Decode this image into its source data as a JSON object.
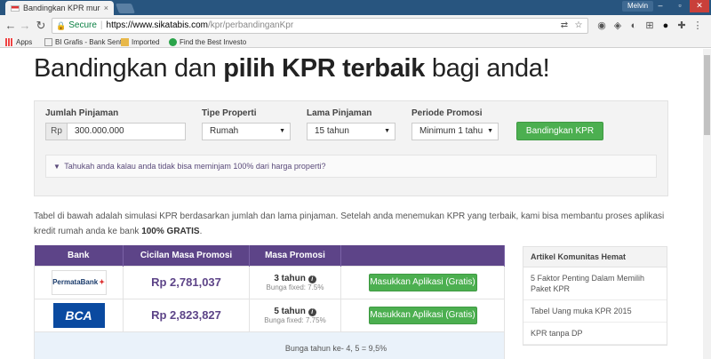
{
  "browser": {
    "tab_title": "Bandingkan KPR murah d",
    "tab_close": "×",
    "user_name": "Melvin",
    "secure_label": "Secure",
    "url_host": "https://www.sikatabis.com",
    "url_path": "/kpr/perbandinganKpr",
    "bookmarks": [
      {
        "label": "Apps"
      },
      {
        "label": "BI Grafis - Bank Sentr"
      },
      {
        "label": "Imported"
      },
      {
        "label": "Find the Best Investo"
      }
    ]
  },
  "page": {
    "headline_prefix": "Bandingkan dan ",
    "headline_bold": "pilih KPR terbaik",
    "headline_suffix": " bagi anda!",
    "form": {
      "amount_label": "Jumlah Pinjaman",
      "amount_prefix": "Rp",
      "amount_value": "300.000.000",
      "property_label": "Tipe Properti",
      "property_value": "Rumah",
      "term_label": "Lama Pinjaman",
      "term_value": "15 tahun",
      "promo_label": "Periode Promosi",
      "promo_value": "Minimum 1 tahu",
      "compare_button": "Bandingkan KPR",
      "tip_text": "Tahukah anda kalau anda tidak bisa meminjam 100% dari harga properti?"
    },
    "intro_text": "Tabel di bawah adalah simulasi KPR berdasarkan jumlah dan lama pinjaman. Setelah anda menemukan KPR yang terbaik, kami bisa membantu proses aplikasi kredit rumah anda ke bank ",
    "intro_bold": "100% GRATIS",
    "intro_end": ".",
    "table": {
      "headers": [
        "Bank",
        "Cicilan Masa Promosi",
        "Masa Promosi",
        ""
      ],
      "rows": [
        {
          "bank": "PermataBank",
          "cicilan": "Rp 2,781,037",
          "masa": "3 tahun",
          "bunga": "Bunga fixed: 7.5%",
          "button": "Masukkan Aplikasi (Gratis)"
        },
        {
          "bank": "BCA",
          "cicilan": "Rp 2,823,827",
          "masa": "5 tahun",
          "bunga": "Bunga fixed: 7.75%",
          "button": "Masukkan Aplikasi (Gratis)"
        }
      ],
      "note": "Bunga tahun ke- 4, 5 = 9,5%"
    },
    "sidebar": {
      "title": "Artikel Komunitas Hemat",
      "items": [
        "5 Faktor Penting Dalam Memilih Paket KPR",
        "Tabel Uang muka KPR 2015",
        "KPR tanpa DP"
      ]
    }
  }
}
